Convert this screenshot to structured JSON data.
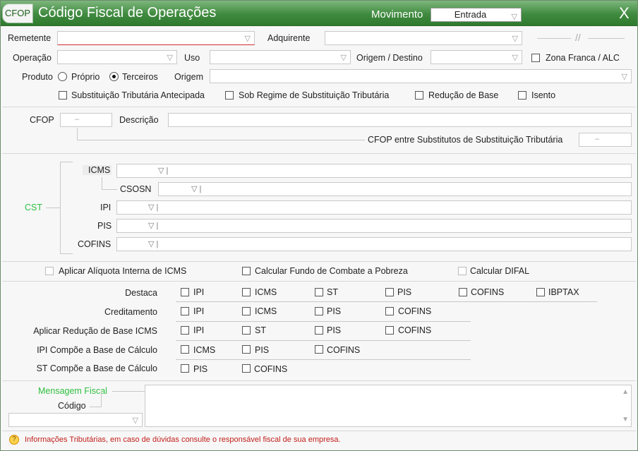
{
  "titlebar": {
    "badge": "CFOP",
    "title": "Código Fiscal de Operações",
    "movimento_label": "Movimento",
    "movimento_value": "Entrada",
    "close": "X"
  },
  "header": {
    "remetente": "Remetente",
    "adquirente": "Adquirente",
    "operacao": "Operação",
    "uso": "Uso",
    "origem_destino": "Origem / Destino",
    "zona_franca": "Zona Franca / ALC",
    "produto": "Produto",
    "proprio": "Próprio",
    "terceiros": "Terceiros",
    "origem": "Origem",
    "sub_trib_antecipada": "Substituição Tributária Antecipada",
    "sob_regime": "Sob Regime de Substituição Tributária",
    "reducao_base": "Redução de Base",
    "isento": "Isento"
  },
  "cfop": {
    "label": "CFOP",
    "code_placeholder": "–",
    "descricao": "Descrição",
    "entre_substitutos": "CFOP entre Substitutos de Substituição Tributária",
    "entre_placeholder": "–"
  },
  "cst": {
    "label": "CST",
    "icms": "ICMS",
    "csosn": "CSOSN",
    "ipi": "IPI",
    "pis": "PIS",
    "cofins": "COFINS"
  },
  "options": {
    "aliquota_interna": "Aplicar Alíquota Interna de ICMS",
    "fundo_pobreza": "Calcular Fundo de Combate a Pobreza",
    "difal": "Calcular DIFAL"
  },
  "taxes": {
    "destaca": {
      "label": "Destaca",
      "items": [
        "IPI",
        "ICMS",
        "ST",
        "PIS",
        "COFINS",
        "IBPTAX"
      ]
    },
    "creditamento": {
      "label": "Creditamento",
      "items": [
        "IPI",
        "ICMS",
        "PIS",
        "COFINS"
      ]
    },
    "reducao": {
      "label": "Aplicar Redução de Base ICMS",
      "items": [
        "IPI",
        "ST",
        "PIS",
        "COFINS"
      ]
    },
    "ipi_base": {
      "label": "IPI Compõe a Base de Cálculo",
      "items": [
        "ICMS",
        "PIS",
        "COFINS"
      ]
    },
    "st_base": {
      "label": "ST Compõe a Base de Cálculo",
      "items": [
        "PIS",
        "COFINS"
      ]
    }
  },
  "mensagem": {
    "label": "Mensagem Fiscal",
    "codigo": "Código"
  },
  "footer": {
    "text": "Informações Tributárias, em caso de dúvidas consulte o responsável fiscal de sua empresa."
  },
  "colors": {
    "title_green": "#3f8a3f",
    "label_green": "#2fbf40",
    "footer_red": "#c0201c"
  }
}
